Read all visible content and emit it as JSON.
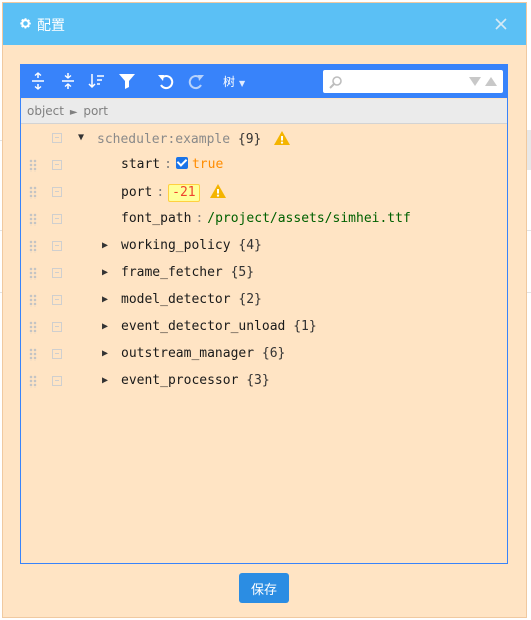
{
  "dialog": {
    "title": "配置",
    "icon": "gear-icon",
    "close_icon": "close-icon",
    "save_label": "保存"
  },
  "toolbar": {
    "tools": [
      "expand-all-icon",
      "collapse-all-icon",
      "sort-icon",
      "filter-icon",
      "undo-icon",
      "redo-icon"
    ],
    "mode_label": "树",
    "search": {
      "value": "",
      "placeholder": ""
    }
  },
  "breadcrumb": {
    "root": "object",
    "separator": "►",
    "current": "port"
  },
  "tree": {
    "root": {
      "key": "scheduler:example",
      "count": "{9}",
      "warning": true
    },
    "start": {
      "key": "start",
      "value": "true",
      "checked": true
    },
    "port": {
      "key": "port",
      "value": "-21",
      "warning": true
    },
    "font_path": {
      "key": "font_path",
      "value": "/project/assets/simhei.ttf"
    },
    "children": [
      {
        "key": "working_policy",
        "count": "{4}"
      },
      {
        "key": "frame_fetcher",
        "count": "{5}"
      },
      {
        "key": "model_detector",
        "count": "{2}"
      },
      {
        "key": "event_detector_unload",
        "count": "{1}"
      },
      {
        "key": "outstream_manager",
        "count": "{6}"
      },
      {
        "key": "event_processor",
        "count": "{3}"
      }
    ]
  },
  "colors": {
    "header": "#5bc0f5",
    "menu": "#3883fa",
    "modal_background": "#ffe4c4",
    "string": "#006000",
    "boolean": "#ff8c00",
    "invalid_number": "#ee422e",
    "save_button": "#2b8de3"
  }
}
